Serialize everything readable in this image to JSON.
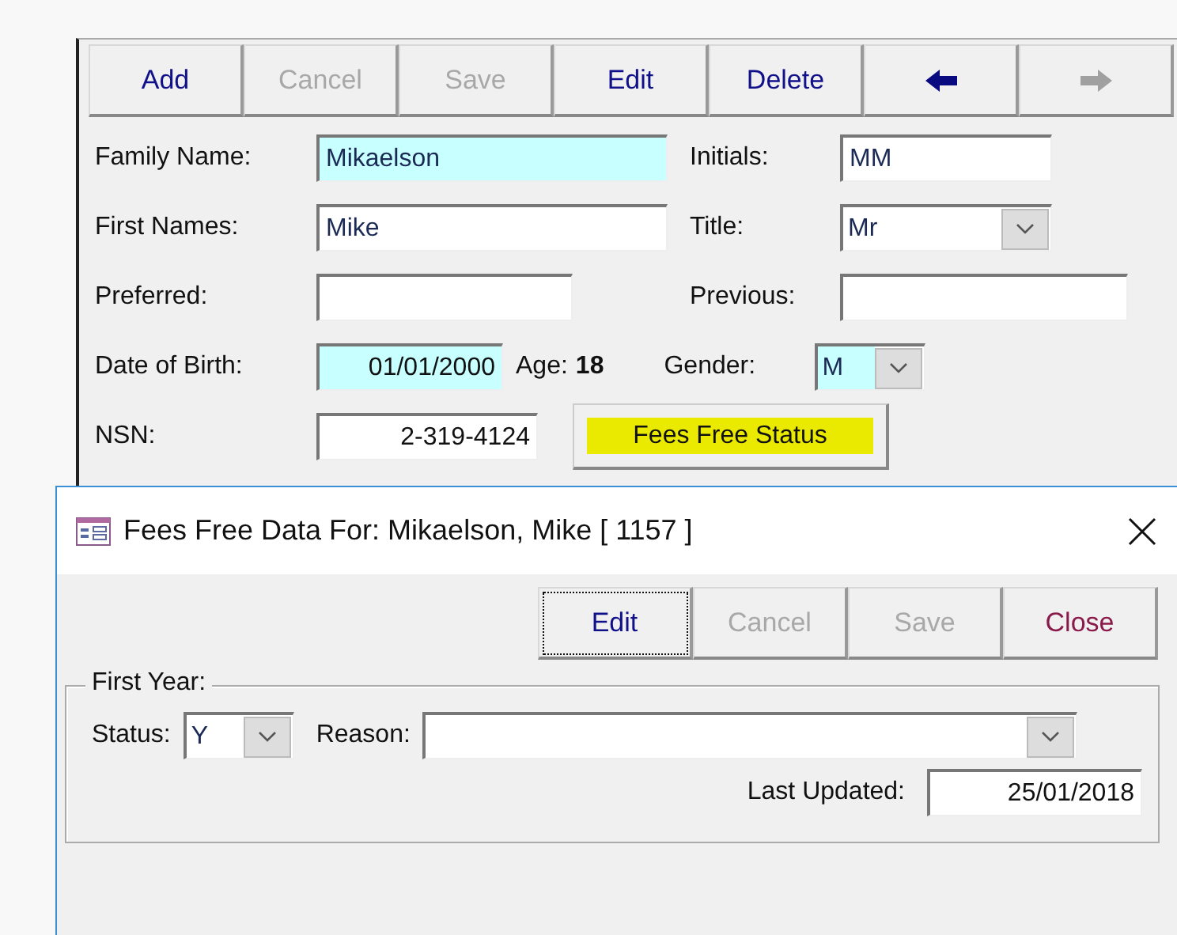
{
  "toolbar": [
    {
      "kind": "text",
      "label": "Add",
      "disabled": false
    },
    {
      "kind": "text",
      "label": "Cancel",
      "disabled": true
    },
    {
      "kind": "text",
      "label": "Save",
      "disabled": true
    },
    {
      "kind": "text",
      "label": "Edit",
      "disabled": false
    },
    {
      "kind": "text",
      "label": "Delete",
      "disabled": false
    },
    {
      "kind": "back",
      "disabled": false
    },
    {
      "kind": "forward",
      "disabled": true
    }
  ],
  "form": {
    "family_name": {
      "label": "Family Name:",
      "value": "Mikaelson",
      "highlighted": true
    },
    "initials": {
      "label": "Initials:",
      "value": "MM"
    },
    "first_names": {
      "label": "First Names:",
      "value": "Mike"
    },
    "title": {
      "label": "Title:",
      "value": "Mr"
    },
    "preferred": {
      "label": "Preferred:"
    },
    "previous": {
      "label": "Previous:"
    },
    "date_of_birth": {
      "label": "Date of Birth:",
      "value": "01/01/2000",
      "highlighted": true
    },
    "age": {
      "label": "Age:",
      "value": "18"
    },
    "gender": {
      "label": "Gender:",
      "value": "M",
      "highlighted": true
    },
    "nsn": {
      "label": "NSN:",
      "value": "2-319-4124"
    },
    "fees_button": {
      "label": "Fees Free Status",
      "highlighted": true
    }
  },
  "dialog": {
    "title": "Fees Free Data For: Mikaelson, Mike [ 1157 ]",
    "buttons": [
      {
        "label": "Edit",
        "disabled": false,
        "focused": true,
        "kind": "command"
      },
      {
        "label": "Cancel",
        "disabled": true,
        "focused": false,
        "kind": "command"
      },
      {
        "label": "Save",
        "disabled": true,
        "focused": false,
        "kind": "command"
      },
      {
        "label": "Close",
        "disabled": false,
        "focused": false,
        "kind": "close"
      }
    ],
    "group": {
      "title": "First Year:",
      "status": {
        "label": "Status:",
        "value": "Y"
      },
      "reason": {
        "label": "Reason:"
      },
      "last_updated": {
        "label": "Last Updated:",
        "value": "25/01/2018"
      }
    }
  }
}
